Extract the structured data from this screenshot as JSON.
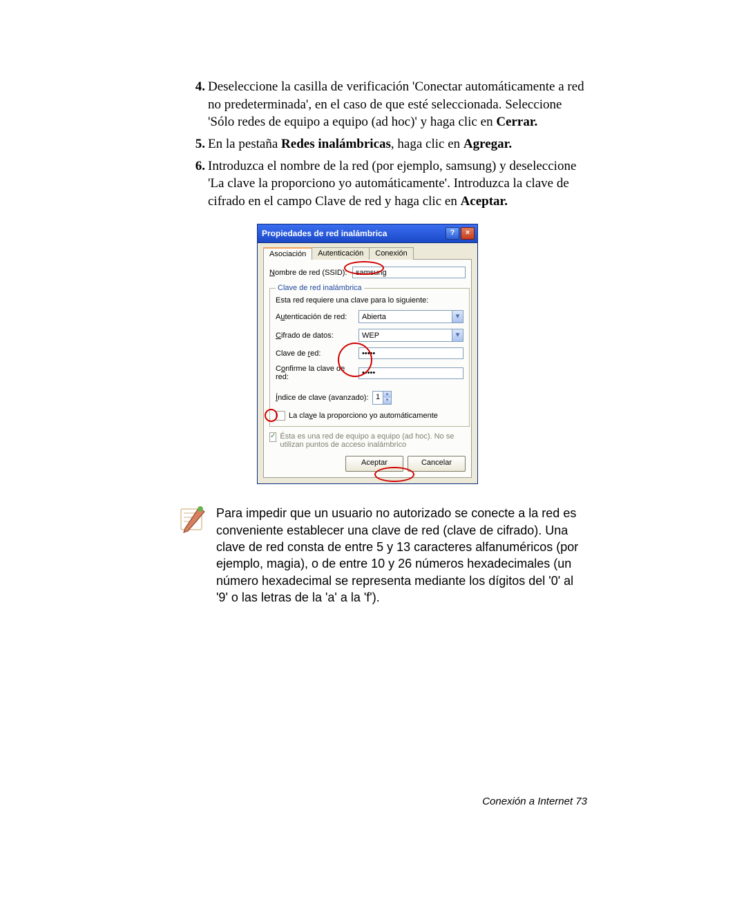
{
  "steps": {
    "s4": {
      "num": "4.",
      "text": "Deseleccione la casilla de verificación 'Conectar automáticamente a red no predeterminada', en el caso de que esté seleccionada. Seleccione 'Sólo redes de equipo a equipo (ad hoc)' y haga clic en ",
      "bold": "Cerrar."
    },
    "s5": {
      "num": "5.",
      "pre": "En la pestaña ",
      "b1": "Redes inalámbricas",
      "mid": ", haga clic en ",
      "b2": "Agregar."
    },
    "s6": {
      "num": "6.",
      "text": "Introduzca el nombre de la red (por ejemplo, samsung) y deseleccione 'La clave la proporciono yo automáticamente'. Introduzca la clave de cifrado en el campo Clave de red y haga clic en ",
      "bold": "Aceptar."
    }
  },
  "dialog": {
    "title": "Propiedades de red inalámbrica",
    "tabs": {
      "t1": "Asociación",
      "t2": "Autenticación",
      "t3": "Conexión"
    },
    "ssid_label_pre": "N",
    "ssid_label": "ombre de red (SSID):",
    "ssid_value": "samsung",
    "group_title": "Clave de red inalámbrica",
    "req_text": "Esta red requiere una clave para lo siguiente:",
    "auth_label_pre": "A",
    "auth_label": "utenticación de red:",
    "auth_value": "Abierta",
    "enc_label_pre": "C",
    "enc_label": "ifrado de datos:",
    "enc_value": "WEP",
    "key_label_pre": "Clave de ",
    "key_label_u": "r",
    "key_label_post": "ed:",
    "key_value": "•••••",
    "confirm_label_pre": "C",
    "confirm_label": "onfirme la clave de red:",
    "confirm_value": "•••••",
    "index_label_pre": "Í",
    "index_label": "ndice de clave (avanzado):",
    "index_value": "1",
    "auto_pre": "L",
    "auto_label": "a clave la proporciono yo automáticamente",
    "adhoc_label": "Ésta es una red de equipo a equipo (ad hoc). No se utilizan puntos de acceso inalámbrico",
    "btn_ok": "Aceptar",
    "btn_cancel": "Cancelar"
  },
  "note": "Para impedir que un usuario no autorizado se conecte a la red es conveniente establecer una clave de red (clave de cifrado). Una clave de red consta de entre 5 y 13 caracteres alfanuméricos (por ejemplo, magia), o de entre 10 y 26 números hexadecimales (un número hexadecimal se representa mediante los dígitos del '0' al '9' o las letras de la 'a' a la 'f').",
  "footer": {
    "text": "Conexión a Internet  ",
    "num": "73"
  }
}
